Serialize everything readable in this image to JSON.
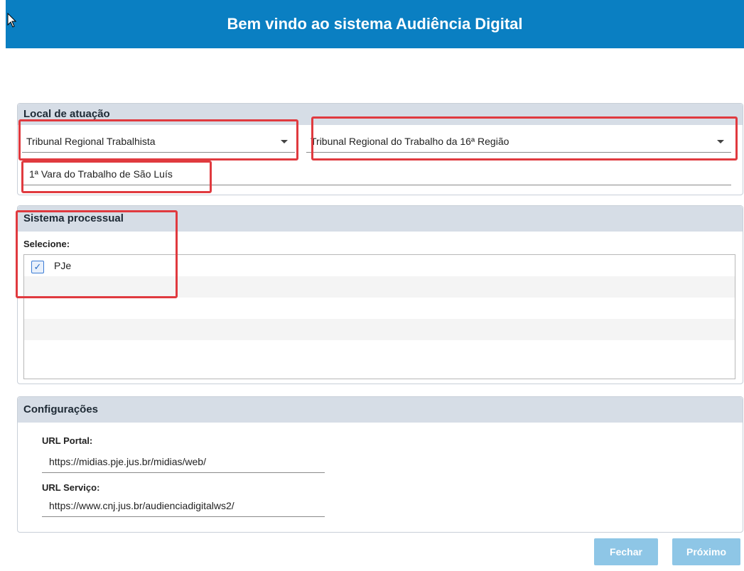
{
  "window": {
    "title": "Bem vindo ao sistema Audiência Digital"
  },
  "local": {
    "header": "Local de atuação",
    "tribunal_type": "Tribunal Regional Trabalhista",
    "tribunal": "Tribunal Regional do Trabalho da 16ª Região",
    "vara": "1ª Vara do Trabalho de São Luís"
  },
  "sistema": {
    "header": "Sistema processual",
    "select_label": "Selecione:",
    "options": [
      {
        "label": "PJe",
        "checked": true
      }
    ]
  },
  "config": {
    "header": "Configurações",
    "portal_label": "URL Portal:",
    "portal_value": "https://midias.pje.jus.br/midias/web/",
    "servico_label": "URL Serviço:",
    "servico_value": "https://www.cnj.jus.br/audienciadigitalws2/"
  },
  "buttons": {
    "close": "Fechar",
    "next": "Próximo"
  },
  "colors": {
    "titlebar": "#0a7fc2",
    "highlight": "#e03a3f",
    "button": "#8ec6e6"
  }
}
